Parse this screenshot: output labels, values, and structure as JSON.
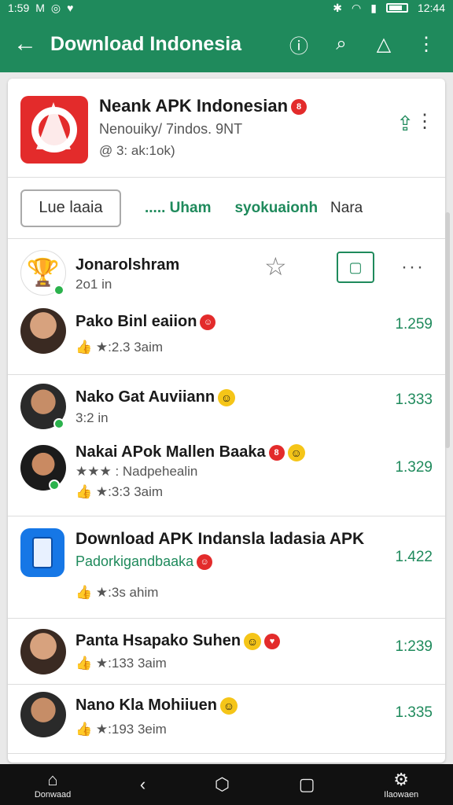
{
  "status": {
    "time_left": "1:59",
    "time_right": "12:44"
  },
  "app_bar": {
    "title": "Download Indonesia"
  },
  "app": {
    "name": "Neank APK Indonesian",
    "developer": "Nenouiky/ 7indos. 9NT",
    "meta": "@ 3: ak:1ok)"
  },
  "tabs": {
    "button": "Lue laaia",
    "tab1": "..... Uham",
    "tab2": "syokuaionh",
    "tab3": "Nara"
  },
  "rows": [
    {
      "title": "Jonarolshram",
      "sub": "2o1 in"
    },
    {
      "title": "Pako Binl eaiion",
      "sub": "★:2.3 3aim",
      "num": "1.259"
    },
    {
      "title": "Nako Gat Auviiann",
      "sub": "3:2 in",
      "num": "1.333"
    },
    {
      "title": "Nakai APok Mallen Baaka",
      "sub": "★★★ : Nadpehealin",
      "sub2": "★:3:3 3aim",
      "num": "1.329"
    },
    {
      "title": "Download APK Indansla ladasia APK",
      "sub": "Padorkigandbaaka",
      "sub2": "★:3s ahim",
      "num": "1.422"
    },
    {
      "title": "Panta Hsapako Suhen",
      "sub": "★:133 3aim",
      "num": "1:239"
    },
    {
      "title": "Nano Kla Mohiiuen",
      "sub": "★:193 3eim",
      "num": "1.335"
    }
  ],
  "nav": {
    "home": "Donwaad",
    "profile": "Ilaowaen"
  },
  "icons": {
    "back": "arrow-left-icon",
    "info": "info-icon",
    "search": "search-icon",
    "alert": "triangle-icon",
    "more": "more-vert-icon",
    "share": "share-icon"
  },
  "colors": {
    "accent": "#1f8a5c",
    "brand_red": "#e32b2b"
  }
}
